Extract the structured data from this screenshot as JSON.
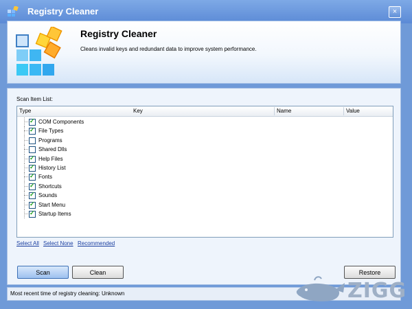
{
  "window": {
    "title": "Registry Cleaner",
    "close_glyph": "×"
  },
  "header": {
    "title": "Registry Cleaner",
    "description": "Cleans invalid keys and redundant data to improve system performance."
  },
  "scan_list": {
    "label": "Scan Item List:",
    "columns": [
      "Type",
      "Key",
      "Name",
      "Value"
    ],
    "items": [
      {
        "label": "COM Components",
        "checked": true
      },
      {
        "label": "File Types",
        "checked": true
      },
      {
        "label": "Programs",
        "checked": false
      },
      {
        "label": "Shared Dlls",
        "checked": false
      },
      {
        "label": "Help Files",
        "checked": true
      },
      {
        "label": "History List",
        "checked": true
      },
      {
        "label": "Fonts",
        "checked": true
      },
      {
        "label": "Shortcuts",
        "checked": true
      },
      {
        "label": "Sounds",
        "checked": true
      },
      {
        "label": "Start Menu",
        "checked": true
      },
      {
        "label": "Startup Items",
        "checked": true
      }
    ]
  },
  "links": {
    "select_all": "Select All",
    "select_none": "Select None",
    "recommended": "Recommended"
  },
  "buttons": {
    "scan": "Scan",
    "clean": "Clean",
    "restore": "Restore"
  },
  "status": {
    "text": "Most recent time of registry cleaning: Unknown"
  },
  "watermark": {
    "text": "ZIGG"
  },
  "colors": {
    "title_bar": "#5b8ad6",
    "link": "#1b3fa0",
    "check": "#21a121"
  }
}
